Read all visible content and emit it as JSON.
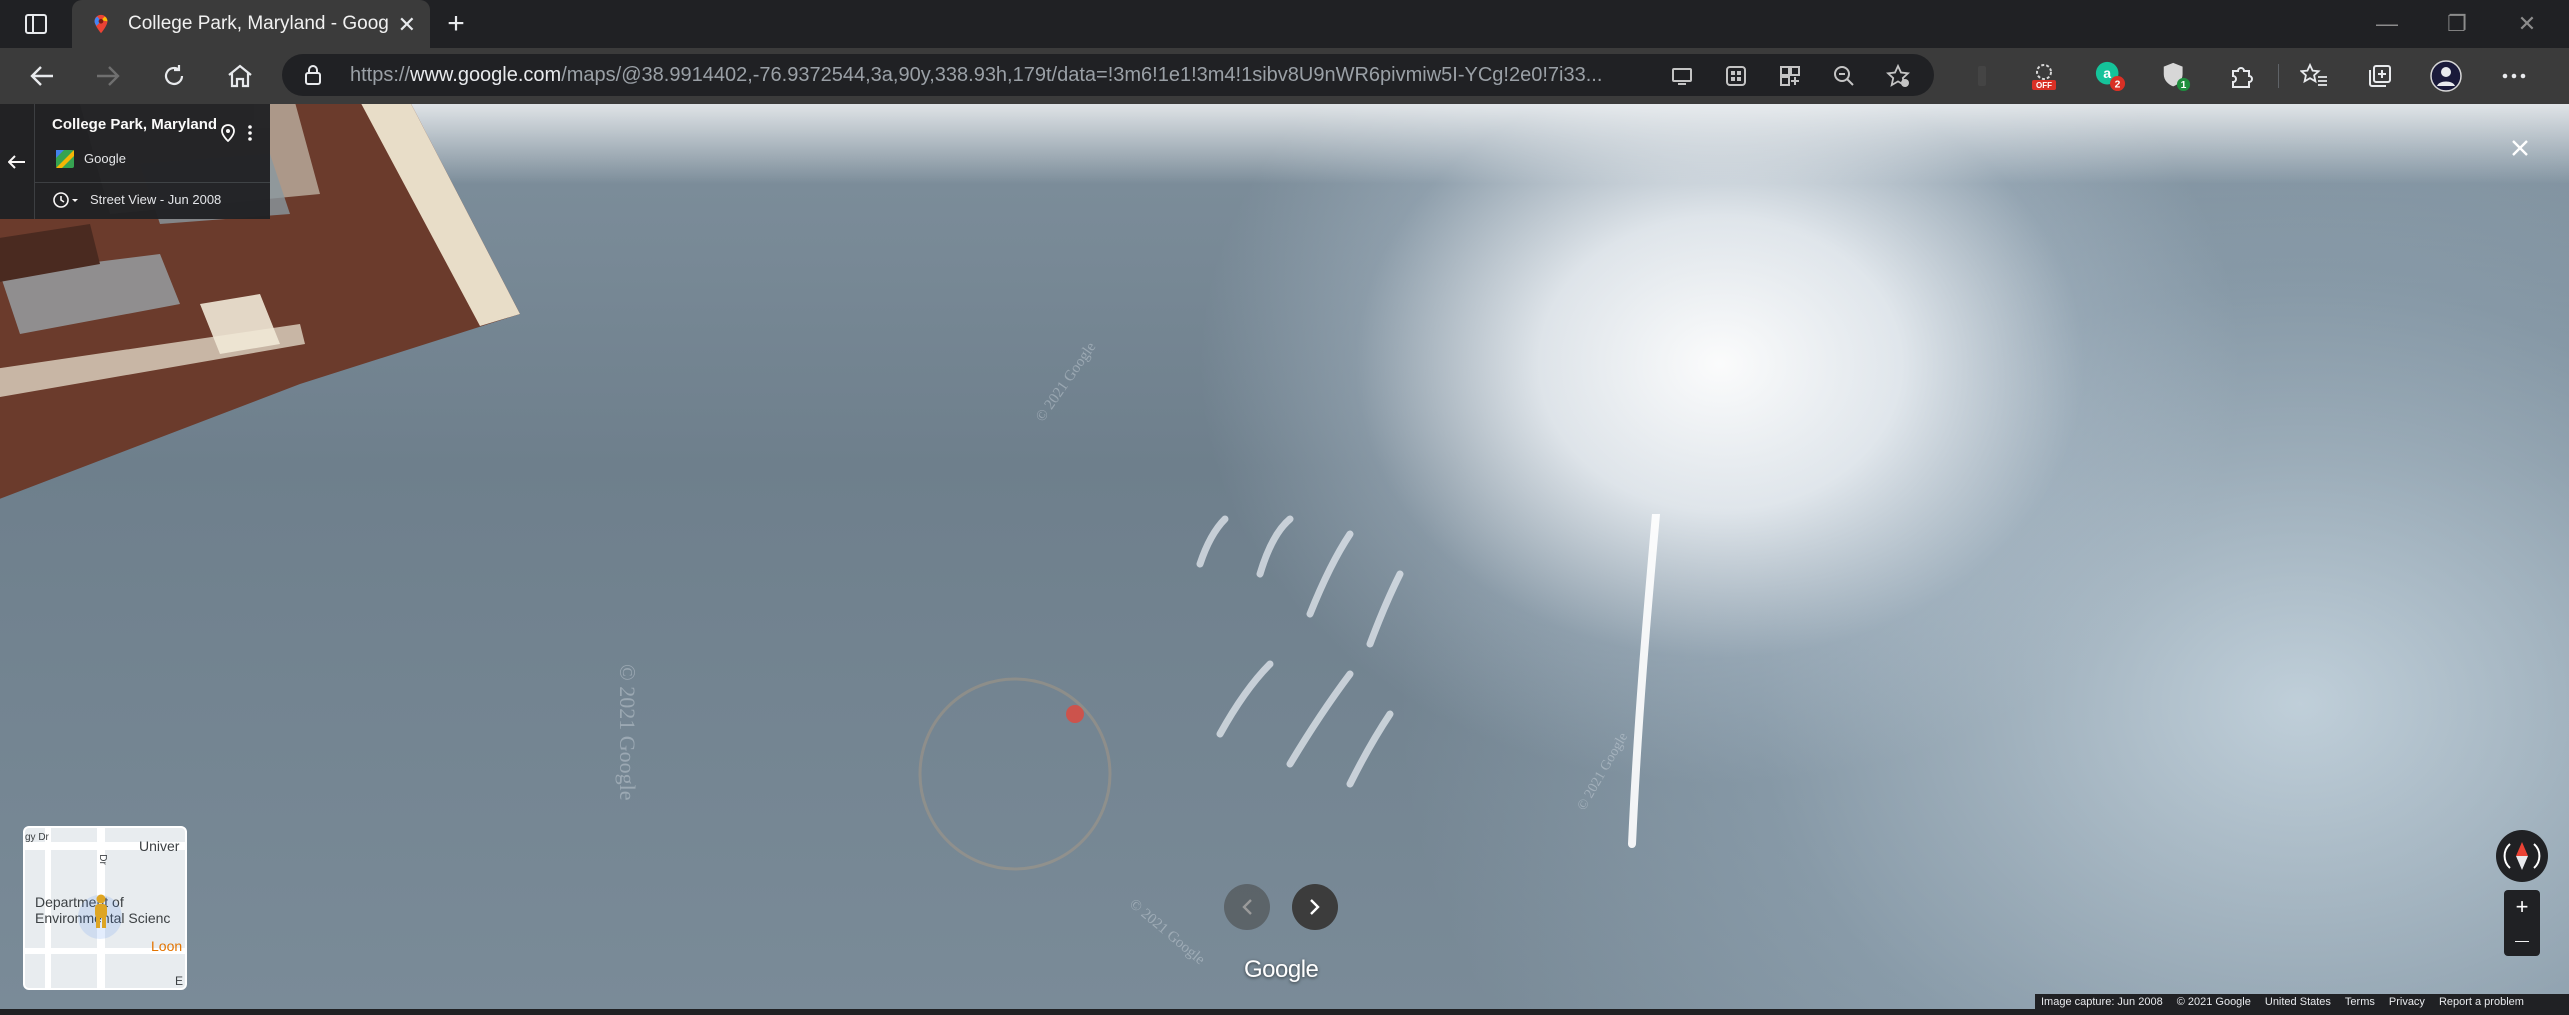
{
  "browser": {
    "tab": {
      "title": "College Park, Maryland - Google Maps",
      "close": "✕"
    },
    "new_tab": "+",
    "window": {
      "minimize": "—",
      "restore": "❐",
      "close": "✕"
    },
    "address": {
      "scheme": "https://",
      "host": "www.google.com",
      "path": "/maps/@38.9914402,-76.9372544,3a,90y,338.93h,179t/data=!3m6!1e1!3m4!1sibv8U9nWR6pivmiw5I-YCg!2e0!7i33..."
    },
    "extensions": [
      {
        "icon": "shield-off-extension-icon",
        "badge": "OFF",
        "badge_color": "#d93025"
      },
      {
        "icon": "grammar-extension-icon",
        "badge": "2",
        "badge_color": "#d93025"
      },
      {
        "icon": "privacy-extension-icon",
        "badge": "1",
        "badge_color": "#1e8e3e"
      }
    ]
  },
  "streetview": {
    "location": "College Park, Maryland",
    "owner": "Google",
    "date_label": "Street View - Jun 2008",
    "watermarks": [
      "© 2021 Google",
      "© 2021 Google",
      "© 2021 Google",
      "© 2021 Google"
    ],
    "brand": "Google",
    "zoom_in": "+",
    "zoom_out": "—",
    "minimap": {
      "labels": [
        "Univer",
        "Department of",
        "Environmental Scienc",
        "Loon",
        "gy Dr",
        "Dr",
        "E"
      ]
    },
    "footer": [
      "Image capture: Jun 2008",
      "© 2021 Google",
      "United States",
      "Terms",
      "Privacy",
      "Report a problem"
    ]
  },
  "colors": {
    "accent_red": "#ea4335",
    "chrome_dark": "#202124",
    "chrome_toolbar": "#3b3b3b"
  }
}
